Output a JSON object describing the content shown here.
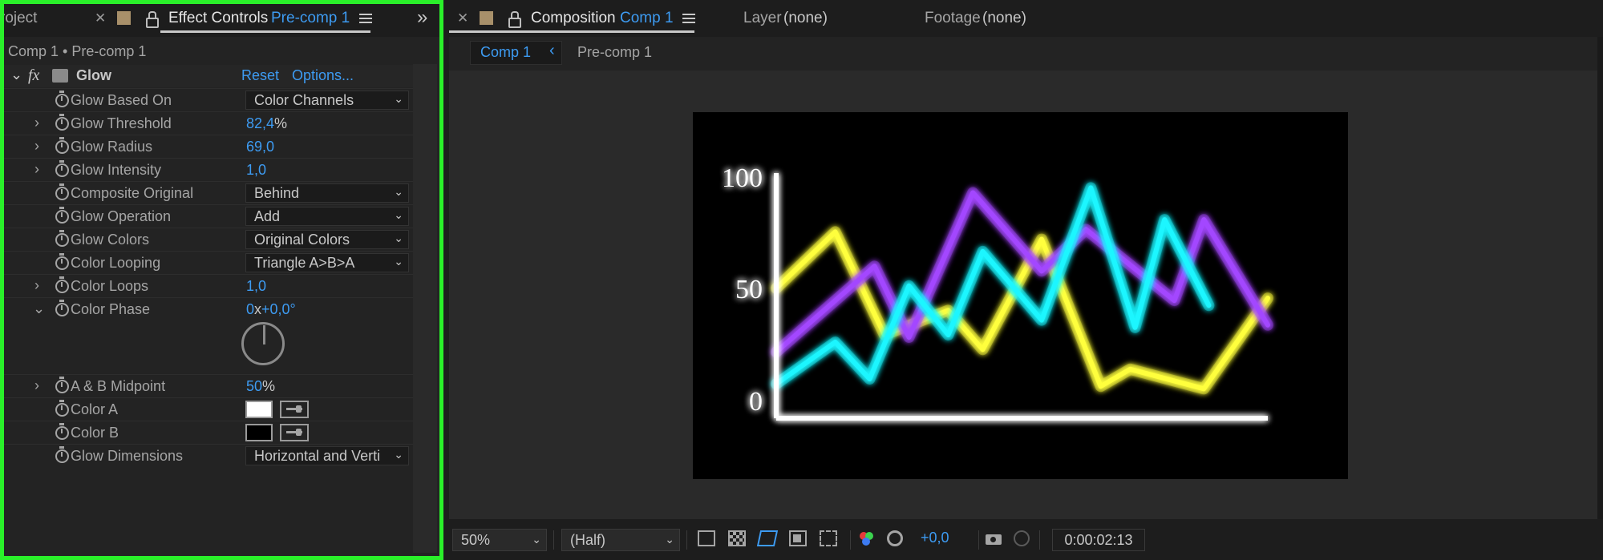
{
  "left_panel": {
    "tabs": {
      "project_label": "roject",
      "effect_controls_label": "Effect Controls",
      "effect_controls_layer": "Pre-comp 1",
      "more_glyph": "»"
    },
    "breadcrumb": "Comp 1 • Pre-comp 1",
    "effect": {
      "name": "Glow",
      "reset_label": "Reset",
      "options_label": "Options..."
    },
    "properties": [
      {
        "label": "Glow Based On",
        "value": "Color Channels",
        "kind": "dropdown"
      },
      {
        "label": "Glow Threshold",
        "value": "82,4",
        "unit": "%",
        "kind": "value"
      },
      {
        "label": "Glow Radius",
        "value": "69,0",
        "kind": "value"
      },
      {
        "label": "Glow Intensity",
        "value": "1,0",
        "kind": "value"
      },
      {
        "label": "Composite Original",
        "value": "Behind",
        "kind": "dropdown"
      },
      {
        "label": "Glow Operation",
        "value": "Add",
        "kind": "dropdown"
      },
      {
        "label": "Glow Colors",
        "value": "Original Colors",
        "kind": "dropdown"
      },
      {
        "label": "Color Looping",
        "value": "Triangle A>B>A",
        "kind": "dropdown"
      },
      {
        "label": "Color Loops",
        "value": "1,0",
        "kind": "value"
      },
      {
        "label": "Color Phase",
        "value_revs": "0",
        "value_sep": "x",
        "value_deg": "+0,0°",
        "kind": "angle"
      },
      {
        "label": "A & B Midpoint",
        "value": "50",
        "unit": "%",
        "kind": "value"
      },
      {
        "label": "Color A",
        "color": "#ffffff",
        "kind": "color"
      },
      {
        "label": "Color B",
        "color": "#000000",
        "kind": "color"
      },
      {
        "label": "Glow Dimensions",
        "value": "Horizontal and Verti",
        "kind": "dropdown"
      }
    ]
  },
  "right_panel": {
    "tabs": {
      "composition_label": "Composition",
      "composition_name": "Comp 1",
      "layer_label": "Layer",
      "layer_value": "(none)",
      "footage_label": "Footage",
      "footage_value": "(none)"
    },
    "flowchart": {
      "current": "Comp 1",
      "next": "Pre-comp 1"
    },
    "chart_data": {
      "type": "line",
      "title": "",
      "xlabel": "",
      "ylabel": "",
      "y_ticks": [
        "100",
        "50",
        "0"
      ],
      "ylim": [
        0,
        100
      ],
      "series": [
        {
          "color": "#ffff3c",
          "points": [
            [
              0,
              53
            ],
            [
              12,
              76
            ],
            [
              22,
              34
            ],
            [
              35,
              44
            ],
            [
              42,
              28
            ],
            [
              54,
              73
            ],
            [
              66,
              13
            ],
            [
              72,
              20
            ],
            [
              87,
              12
            ],
            [
              100,
              49
            ]
          ]
        },
        {
          "color": "#a347ff",
          "points": [
            [
              0,
              27
            ],
            [
              20,
              62
            ],
            [
              27,
              33
            ],
            [
              40,
              92
            ],
            [
              54,
              60
            ],
            [
              63,
              77
            ],
            [
              81,
              48
            ],
            [
              87,
              81
            ],
            [
              100,
              38
            ]
          ]
        },
        {
          "color": "#1ef6ff",
          "points": [
            [
              0,
              14
            ],
            [
              12,
              31
            ],
            [
              19,
              16
            ],
            [
              27,
              54
            ],
            [
              35,
              34
            ],
            [
              42,
              68
            ],
            [
              54,
              40
            ],
            [
              64,
              94
            ],
            [
              73,
              37
            ],
            [
              79,
              81
            ],
            [
              88,
              46
            ]
          ]
        }
      ],
      "legend": "none",
      "grid": false
    },
    "bottom_bar": {
      "zoom": "50%",
      "resolution": "(Half)",
      "exposure": "+0,0",
      "timecode": "0:00:02:13"
    }
  }
}
